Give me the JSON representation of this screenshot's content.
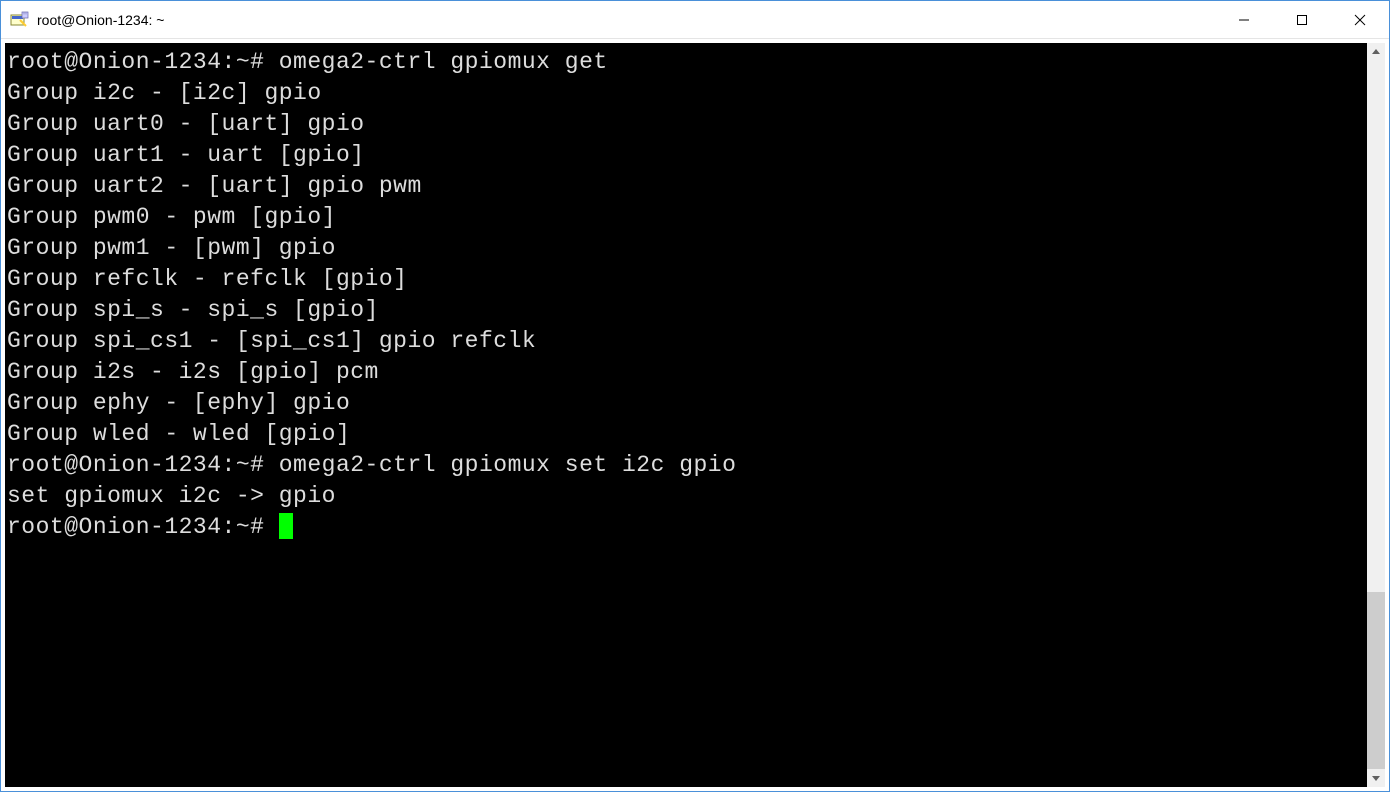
{
  "window": {
    "title": "root@Onion-1234: ~"
  },
  "terminal": {
    "lines": [
      "root@Onion-1234:~# omega2-ctrl gpiomux get",
      "Group i2c - [i2c] gpio",
      "Group uart0 - [uart] gpio",
      "Group uart1 - uart [gpio]",
      "Group uart2 - [uart] gpio pwm",
      "Group pwm0 - pwm [gpio]",
      "Group pwm1 - [pwm] gpio",
      "Group refclk - refclk [gpio]",
      "Group spi_s - spi_s [gpio]",
      "Group spi_cs1 - [spi_cs1] gpio refclk",
      "Group i2s - i2s [gpio] pcm",
      "Group ephy - [ephy] gpio",
      "Group wled - wled [gpio]",
      "root@Onion-1234:~# omega2-ctrl gpiomux set i2c gpio",
      "set gpiomux i2c -> gpio",
      "root@Onion-1234:~# "
    ]
  }
}
